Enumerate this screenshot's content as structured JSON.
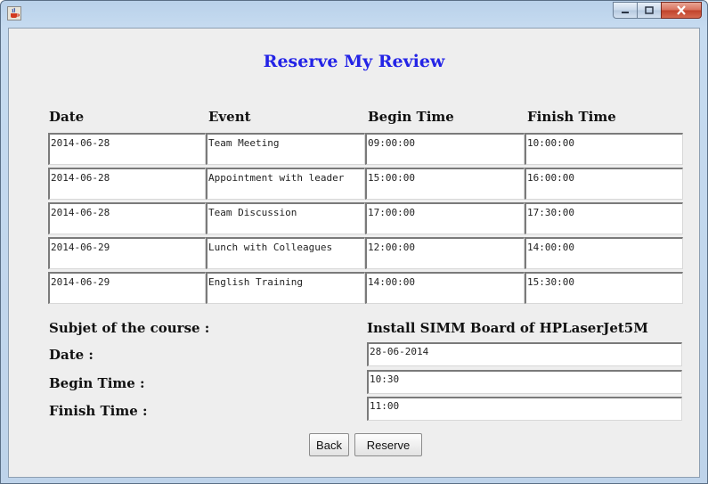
{
  "window": {
    "icons": {
      "app": "java-cup-icon",
      "minimize": "minimize-icon",
      "maximize": "maximize-icon",
      "close": "close-icon"
    }
  },
  "title": "Reserve My Review",
  "columns": [
    "Date",
    "Event",
    "Begin Time",
    "Finish Time"
  ],
  "rows": [
    [
      "2014-06-28",
      "Team Meeting",
      "09:00:00",
      "10:00:00"
    ],
    [
      "2014-06-28",
      "Appointment with leader",
      "15:00:00",
      "16:00:00"
    ],
    [
      "2014-06-28",
      "Team Discussion",
      "17:00:00",
      "17:30:00"
    ],
    [
      "2014-06-29",
      "Lunch with Colleagues",
      "12:00:00",
      "14:00:00"
    ],
    [
      "2014-06-29",
      "English Training",
      "14:00:00",
      "15:30:00"
    ]
  ],
  "form": {
    "subject_label": "Subjet of the course :",
    "subject_value": "Install SIMM Board of HPLaserJet5M",
    "date_label": "Date :",
    "date_value": "28-06-2014",
    "begin_label": "Begin Time :",
    "begin_value": "10:30",
    "finish_label": "Finish Time :",
    "finish_value": "11:00"
  },
  "buttons": {
    "back": "Back",
    "reserve": "Reserve"
  },
  "colors": {
    "title": "#2323e6",
    "panel": "#eeeeee",
    "frame": "#b9d1ea"
  }
}
